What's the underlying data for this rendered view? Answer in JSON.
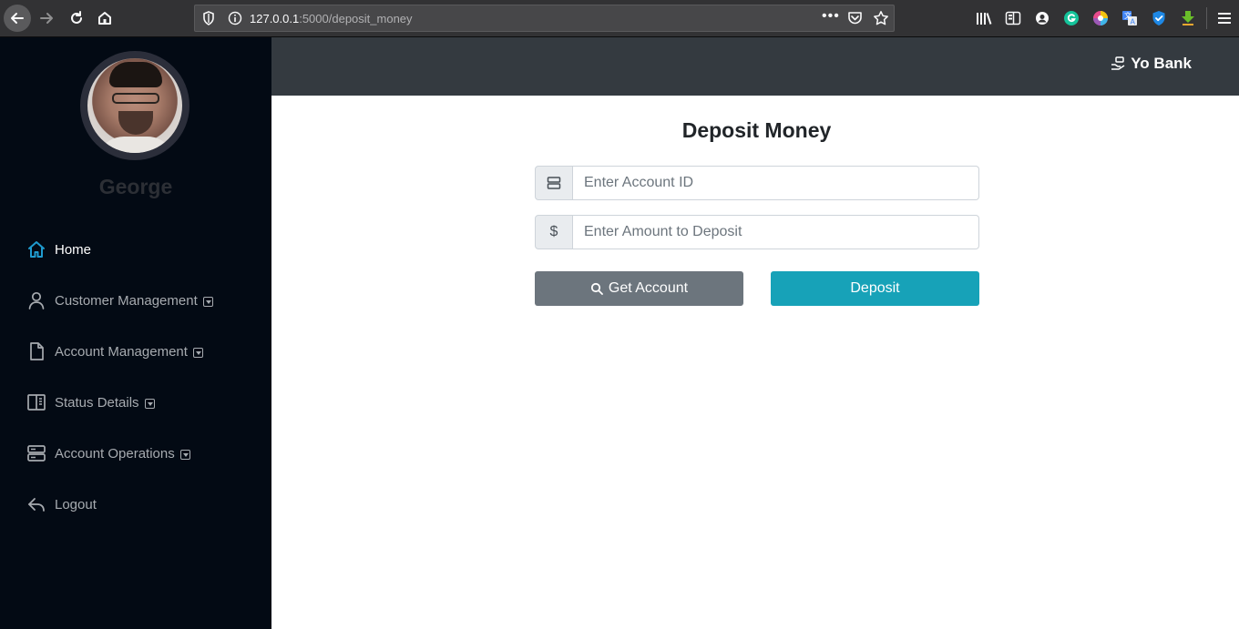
{
  "browser": {
    "url_host": "127.0.0.1",
    "url_path": ":5000/deposit_money",
    "more_label": "•••"
  },
  "sidebar": {
    "user_name": "George",
    "items": [
      {
        "label": "Home",
        "icon": "home-icon",
        "active": true
      },
      {
        "label": "Customer Management",
        "icon": "user-icon",
        "dropdown": true
      },
      {
        "label": "Account Management",
        "icon": "document-icon",
        "dropdown": true
      },
      {
        "label": "Status Details",
        "icon": "columns-icon",
        "dropdown": true
      },
      {
        "label": "Account Operations",
        "icon": "server-icon",
        "dropdown": true
      },
      {
        "label": "Logout",
        "icon": "reply-icon"
      }
    ]
  },
  "header": {
    "brand": "Yo Bank"
  },
  "main": {
    "title": "Deposit Money",
    "account_id": {
      "placeholder": "Enter Account ID",
      "icon": "server-icon"
    },
    "amount": {
      "placeholder": "Enter Amount to Deposit",
      "prefix": "$"
    },
    "get_account_label": "Get Account",
    "deposit_label": "Deposit"
  },
  "colors": {
    "sidebar_bg": "#030a14",
    "header_bg": "#343a40",
    "active_icon": "#1f9bcf",
    "btn_secondary": "#6c757d",
    "btn_info": "#17a2b8"
  }
}
